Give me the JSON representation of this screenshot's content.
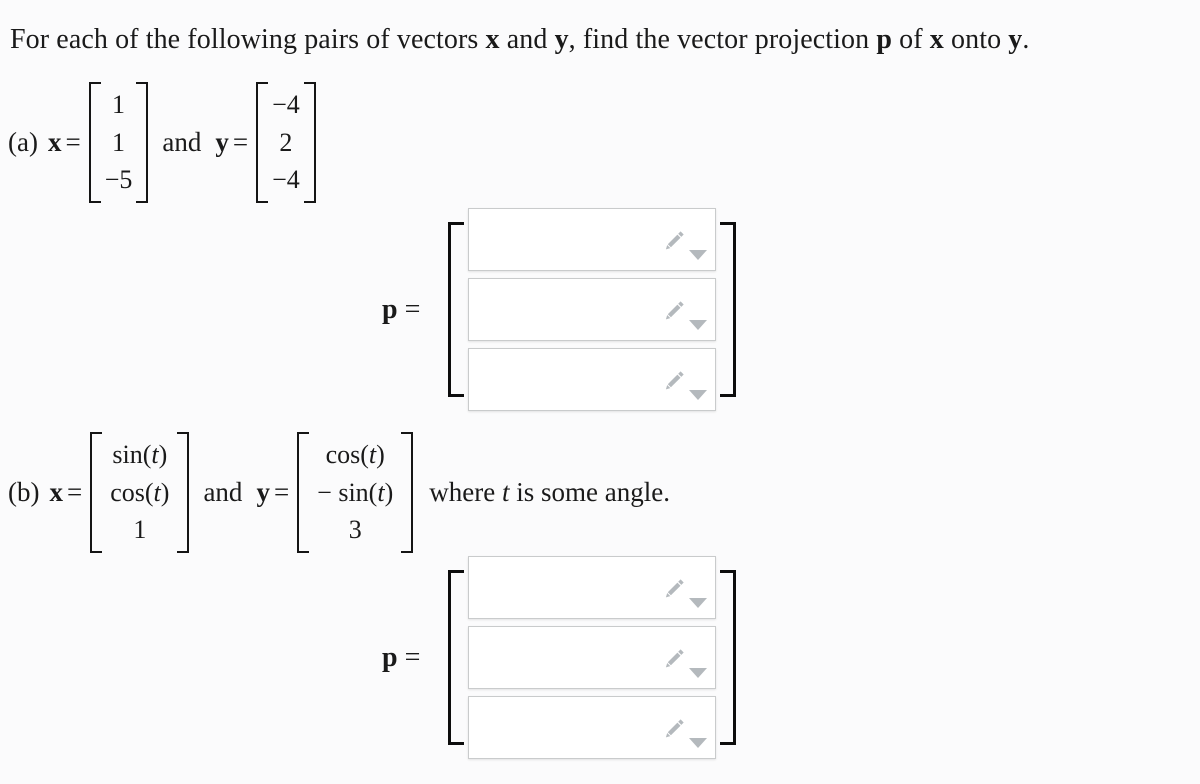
{
  "prompt": {
    "segment_1": "For each of the following pairs of vectors ",
    "vec_x_1": "x",
    "segment_2": " and ",
    "vec_y_1": "y",
    "segment_3": ", find the vector projection ",
    "vec_p": "p",
    "segment_4": " of ",
    "vec_x_2": "x",
    "segment_5": " onto ",
    "vec_y_2": "y",
    "segment_6": "."
  },
  "problems": [
    {
      "label": "(a)",
      "x_symbol": "x",
      "equals": "=",
      "x_entries": [
        "1",
        "1",
        "−5"
      ],
      "conjunction": "and",
      "y_symbol": "y",
      "y_equals": "=",
      "y_entries": [
        "−4",
        "2",
        "−4"
      ],
      "trailing": ""
    },
    {
      "label": "(b)",
      "x_symbol": "x",
      "equals": "=",
      "x_entries": [
        "sin(t)",
        "cos(t)",
        "1"
      ],
      "conjunction": "and",
      "y_symbol": "y",
      "y_equals": "=",
      "y_entries": [
        "cos(t)",
        "− sin(t)",
        "3"
      ],
      "trailing": "where t is some angle."
    }
  ],
  "answers": [
    {
      "for_problem": "(a)",
      "p_symbol": "p",
      "equals": "=",
      "fields": [
        {
          "value": "",
          "placeholder": "",
          "edit_icon": "pencil-icon",
          "menu_icon": "caret-down-icon"
        },
        {
          "value": "",
          "placeholder": "",
          "edit_icon": "pencil-icon",
          "menu_icon": "caret-down-icon"
        },
        {
          "value": "",
          "placeholder": "",
          "edit_icon": "pencil-icon",
          "menu_icon": "caret-down-icon"
        }
      ]
    },
    {
      "for_problem": "(b)",
      "p_symbol": "p",
      "equals": "=",
      "fields": [
        {
          "value": "",
          "placeholder": "",
          "edit_icon": "pencil-icon",
          "menu_icon": "caret-down-icon"
        },
        {
          "value": "",
          "placeholder": "",
          "edit_icon": "pencil-icon",
          "menu_icon": "caret-down-icon"
        },
        {
          "value": "",
          "placeholder": "",
          "edit_icon": "pencil-icon",
          "menu_icon": "caret-down-icon"
        }
      ]
    }
  ],
  "colors": {
    "page_background": "#fbfbfc",
    "field_background": "#ffffff",
    "field_border": "#c9cbcc",
    "icon_gray": "#b4b9bd",
    "text": "#1a1a1a"
  }
}
